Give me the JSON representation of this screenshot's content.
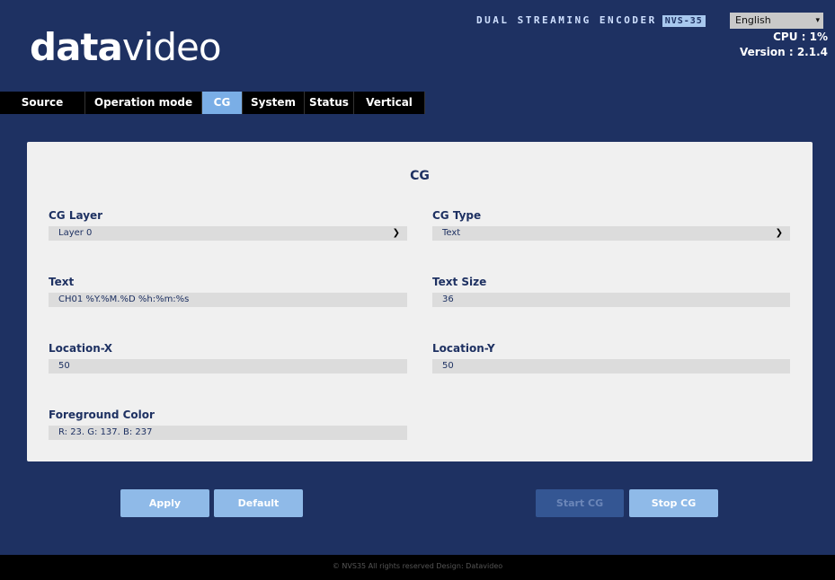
{
  "header": {
    "logo_bold": "data",
    "logo_light": "video",
    "product": "DUAL STREAMING ENCODER",
    "model": "NVS-35",
    "language": "English",
    "cpu": "CPU : 1%",
    "version": "Version : 2.1.4"
  },
  "nav": {
    "tabs": [
      "Source",
      "Operation mode",
      "CG",
      "System",
      "Status",
      "Vertical"
    ],
    "active": "CG"
  },
  "panel": {
    "title": "CG",
    "cg_layer": {
      "label": "CG Layer",
      "value": "Layer 0"
    },
    "cg_type": {
      "label": "CG Type",
      "value": "Text"
    },
    "text": {
      "label": "Text",
      "value": "CH01 %Y.%M.%D %h:%m:%s"
    },
    "text_size": {
      "label": "Text Size",
      "value": "36"
    },
    "location_x": {
      "label": "Location-X",
      "value": "50"
    },
    "location_y": {
      "label": "Location-Y",
      "value": "50"
    },
    "foreground": {
      "label": "Foreground Color",
      "value": "R: 23. G: 137. B: 237"
    }
  },
  "buttons": {
    "apply": "Apply",
    "default": "Default",
    "start_cg": "Start CG",
    "stop_cg": "Stop CG"
  },
  "footer": "© NVS35 All rights reserved Design: Datavideo",
  "colors": {
    "background": "#1e3162",
    "accent": "#7aaee6",
    "panel": "#f0f0f0"
  }
}
